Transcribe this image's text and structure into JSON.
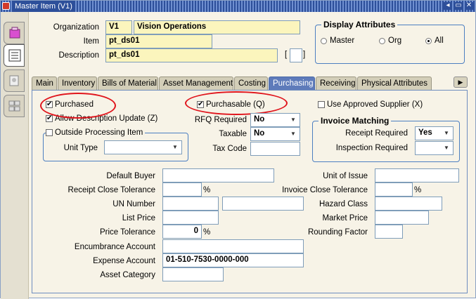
{
  "window": {
    "title": "Master Item (V1)",
    "controls": [
      "◂",
      "▭",
      "✕"
    ]
  },
  "left_tabs": [
    "cube-icon",
    "list-icon",
    "catalog-icon",
    "grid-icon"
  ],
  "header": {
    "organization_label": "Organization",
    "organization_code": "V1",
    "organization_name": "Vision Operations",
    "item_label": "Item",
    "item_value": "pt_ds01",
    "description_label": "Description",
    "description_value": "pt_ds01",
    "description_ext": "[",
    "description_ext_close": "]"
  },
  "display_attributes": {
    "title": "Display Attributes",
    "options": [
      {
        "label": "Master",
        "selected": false
      },
      {
        "label": "Org",
        "selected": false
      },
      {
        "label": "All",
        "selected": true
      }
    ]
  },
  "tabs": [
    {
      "label": "Main",
      "active": false
    },
    {
      "label": "Inventory",
      "active": false
    },
    {
      "label": "Bills of Material",
      "active": false
    },
    {
      "label": "Asset Management",
      "active": false
    },
    {
      "label": "Costing",
      "active": false
    },
    {
      "label": "Purchasing",
      "active": true
    },
    {
      "label": "Receiving",
      "active": false
    },
    {
      "label": "Physical Attributes",
      "active": false
    }
  ],
  "tab_next": "▶",
  "purchasing": {
    "purchased_label": "Purchased",
    "purchased_checked": true,
    "allow_desc_update_label": "Allow Description Update (Z)",
    "allow_desc_update_checked": true,
    "purchasable_label": "Purchasable (Q)",
    "purchasable_checked": true,
    "use_approved_supplier_label": "Use Approved Supplier (X)",
    "use_approved_supplier_checked": false,
    "rfq_required_label": "RFQ Required",
    "rfq_required_value": "No",
    "taxable_label": "Taxable",
    "taxable_value": "No",
    "tax_code_label": "Tax Code",
    "tax_code_value": "",
    "outside_processing": {
      "label": "Outside Processing Item",
      "checked": false,
      "unit_type_label": "Unit Type",
      "unit_type_value": ""
    },
    "invoice_matching": {
      "title": "Invoice Matching",
      "receipt_required_label": "Receipt Required",
      "receipt_required_value": "Yes",
      "inspection_required_label": "Inspection Required",
      "inspection_required_value": ""
    },
    "fields": {
      "default_buyer_label": "Default Buyer",
      "default_buyer_value": "",
      "receipt_close_tolerance_label": "Receipt Close Tolerance",
      "receipt_close_tolerance_value": "",
      "percent": "%",
      "un_number_label": "UN Number",
      "un_number_value": "",
      "un_number_desc": "",
      "list_price_label": "List Price",
      "list_price_value": "",
      "price_tolerance_label": "Price Tolerance",
      "price_tolerance_value": "0",
      "encumbrance_account_label": "Encumbrance Account",
      "encumbrance_account_value": "",
      "expense_account_label": "Expense Account",
      "expense_account_value": "01-510-7530-0000-000",
      "asset_category_label": "Asset Category",
      "asset_category_value": "",
      "unit_of_issue_label": "Unit of Issue",
      "unit_of_issue_value": "",
      "invoice_close_tolerance_label": "Invoice Close Tolerance",
      "invoice_close_tolerance_value": "",
      "hazard_class_label": "Hazard Class",
      "hazard_class_value": "",
      "market_price_label": "Market Price",
      "market_price_value": "",
      "rounding_factor_label": "Rounding Factor",
      "rounding_factor_value": ""
    }
  },
  "colors": {
    "annotation_red": "#e0141c",
    "active_tab": "#5e7bba",
    "required_field": "#fbf5bd",
    "panel_bg": "#f7f3e7"
  }
}
